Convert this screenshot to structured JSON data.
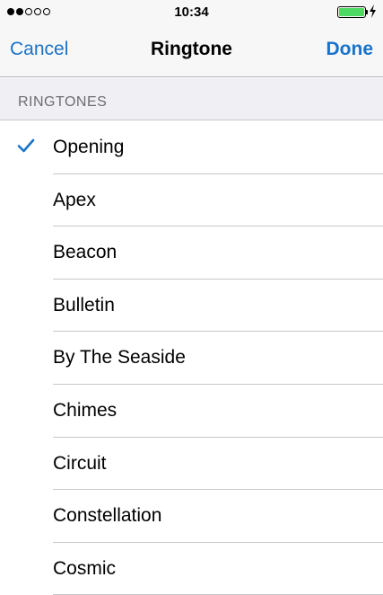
{
  "status_bar": {
    "time": "10:34",
    "signal_strength": 2,
    "signal_total": 5,
    "battery_level": 1.0,
    "battery_color": "#4cd964",
    "battery_icon": "battery-icon",
    "charging_icon": "lightning-bolt-icon"
  },
  "nav": {
    "cancel_label": "Cancel",
    "title": "Ringtone",
    "done_label": "Done",
    "accent_color": "#1a73c9"
  },
  "section": {
    "header": "RINGTONES"
  },
  "ringtones": [
    {
      "label": "Opening",
      "selected": true
    },
    {
      "label": "Apex",
      "selected": false
    },
    {
      "label": "Beacon",
      "selected": false
    },
    {
      "label": "Bulletin",
      "selected": false
    },
    {
      "label": "By The Seaside",
      "selected": false
    },
    {
      "label": "Chimes",
      "selected": false
    },
    {
      "label": "Circuit",
      "selected": false
    },
    {
      "label": "Constellation",
      "selected": false
    },
    {
      "label": "Cosmic",
      "selected": false
    }
  ]
}
